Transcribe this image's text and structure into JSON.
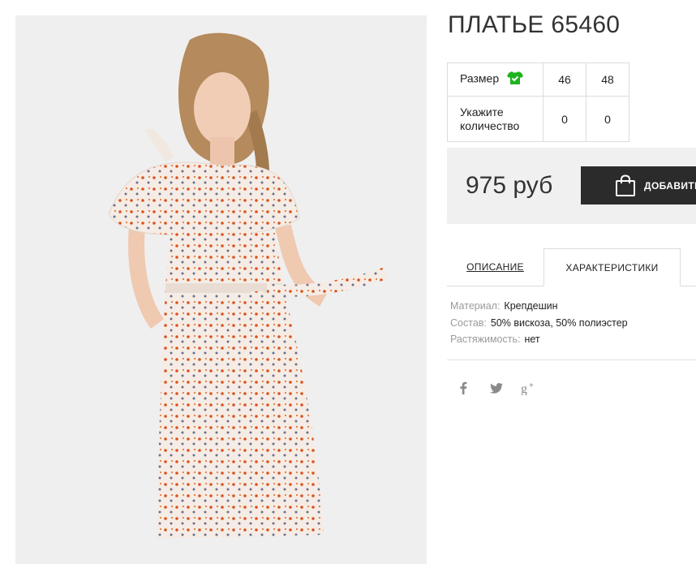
{
  "product": {
    "title": "ПЛАТЬЕ 65460",
    "photo_alt": "dress-photo"
  },
  "sizes": {
    "size_label": "Размер",
    "qty_label": "Укажите количество",
    "columns": [
      "46",
      "48"
    ],
    "quantities": [
      "0",
      "0"
    ],
    "size_icon": "tshirt-check-icon",
    "icon_color": "#1fb31f"
  },
  "buy": {
    "price": "975 руб",
    "add_label": "ДОБАВИТЬ"
  },
  "tabs": [
    {
      "label": "ОПИСАНИЕ",
      "active": false
    },
    {
      "label": "ХАРАКТЕРИСТИКИ",
      "active": true
    }
  ],
  "specs": [
    {
      "key": "Материал:",
      "value": "Крепдешин"
    },
    {
      "key": "Состав:",
      "value": "50% вискоза, 50% полиэстер"
    },
    {
      "key": "Растяжимость:",
      "value": "нет"
    }
  ],
  "social": [
    {
      "name": "facebook-icon",
      "glyph": "f"
    },
    {
      "name": "twitter-icon",
      "glyph": "t"
    },
    {
      "name": "google-plus-icon",
      "glyph": "g+"
    }
  ]
}
